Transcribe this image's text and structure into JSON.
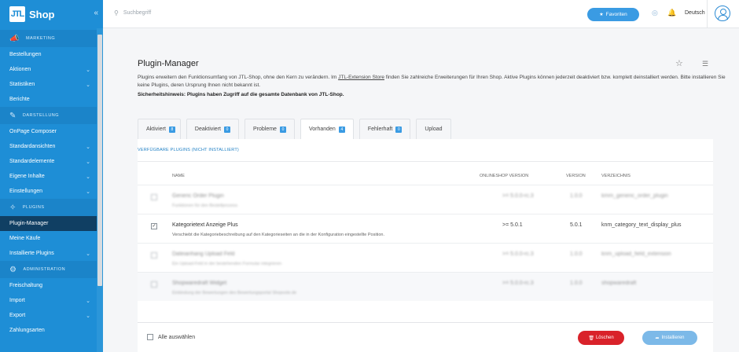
{
  "brand": {
    "logo_mark": "JTL",
    "name": "Shop"
  },
  "sidebar": {
    "sections": [
      {
        "title": "MARKETING",
        "icon": "megaphone-icon",
        "items": [
          {
            "label": "Bestellungen",
            "chevron": false
          },
          {
            "label": "Aktionen",
            "chevron": true
          },
          {
            "label": "Statistiken",
            "chevron": true
          },
          {
            "label": "Berichte",
            "chevron": false
          }
        ]
      },
      {
        "title": "DARSTELLUNG",
        "icon": "brush-icon",
        "items": [
          {
            "label": "OnPage Composer",
            "chevron": false
          },
          {
            "label": "Standardansichten",
            "chevron": true
          },
          {
            "label": "Standardelemente",
            "chevron": true
          },
          {
            "label": "Eigene Inhalte",
            "chevron": true
          },
          {
            "label": "Einstellungen",
            "chevron": true
          }
        ]
      },
      {
        "title": "PLUGINS",
        "icon": "puzzle-icon",
        "items": [
          {
            "label": "Plugin-Manager",
            "chevron": false,
            "active": true
          },
          {
            "label": "Meine Käufe",
            "chevron": false
          },
          {
            "label": "Installierte Plugins",
            "chevron": true
          }
        ]
      },
      {
        "title": "ADMINISTRATION",
        "icon": "gear-icon",
        "items": [
          {
            "label": "Freischaltung",
            "chevron": false
          },
          {
            "label": "Import",
            "chevron": true
          },
          {
            "label": "Export",
            "chevron": true
          },
          {
            "label": "Zahlungsarten",
            "chevron": false
          }
        ]
      }
    ]
  },
  "topbar": {
    "search_placeholder": "Suchbegriff",
    "favorites_label": "Favoriten",
    "language": "Deutsch"
  },
  "page": {
    "title": "Plugin-Manager",
    "desc_part1": "Plugins erweitern den Funktionsumfang von JTL-Shop, ohne den Kern zu verändern. Im ",
    "desc_link": "JTL-Extension Store",
    "desc_part2": " finden Sie zahlreiche Erweiterungen für Ihren Shop. Aktive Plugins können jederzeit deaktiviert bzw. komplett deinstalliert werden. Bitte installieren Sie keine Plugins, deren Ursprung Ihnen nicht bekannt ist.",
    "warning": "Sicherheitshinweis: Plugins haben Zugriff auf die gesamte Datenbank von JTL-Shop."
  },
  "tabs": [
    {
      "label": "Aktiviert",
      "badge": "8"
    },
    {
      "label": "Deaktiviert",
      "badge": "0"
    },
    {
      "label": "Probleme",
      "badge": "0"
    },
    {
      "label": "Vorhanden",
      "badge": "4",
      "active": true
    },
    {
      "label": "Fehlerhaft",
      "badge": "0"
    },
    {
      "label": "Upload",
      "badge": ""
    }
  ],
  "panel": {
    "heading": "VERFÜGBARE PLUGINS (NICHT INSTALLIERT)",
    "columns": {
      "name": "NAME",
      "shop_version": "ONLINESHOP VERSION",
      "version": "VERSION",
      "directory": "VERZEICHNIS"
    },
    "rows": [
      {
        "name": "Generic Order Plugin",
        "desc": "Funktionen für den Bestellprozess",
        "shop_version": ">= 5.0.0-rc.3",
        "version": "1.0.0",
        "dir": "kmm_generic_order_plugin",
        "checked": false,
        "blurred": true
      },
      {
        "name": "Kategorietext Anzeige Plus",
        "desc": "Verschiebt die Kategoriebeschreibung auf den Kategorieseiten an die in der Konfiguration eingestellte Position.",
        "shop_version": ">= 5.0.1",
        "version": "5.0.1",
        "dir": "knm_category_text_display_plus",
        "checked": true,
        "blurred": false
      },
      {
        "name": "Dateianhang Upload Feld",
        "desc": "Ein Upload-Feld in der bestehenden Formular integrieren",
        "shop_version": ">= 5.0.0-rc.3",
        "version": "1.0.0",
        "dir": "knm_upload_field_extension",
        "checked": false,
        "blurred": true
      },
      {
        "name": "Shopwaredraft Widget",
        "desc": "Einbindung der Bewertungen des Bewertungsportal Shopvote.de",
        "shop_version": ">= 5.0.0-rc.3",
        "version": "1.0.0",
        "dir": "shopwaredraft",
        "checked": false,
        "blurred": true
      }
    ]
  },
  "footer": {
    "select_all": "Alle auswählen",
    "delete_label": "Löschen",
    "install_label": "Installieren"
  },
  "colors": {
    "accent": "#1e8ed6",
    "active_nav": "#103f63",
    "danger": "#d9222a"
  }
}
